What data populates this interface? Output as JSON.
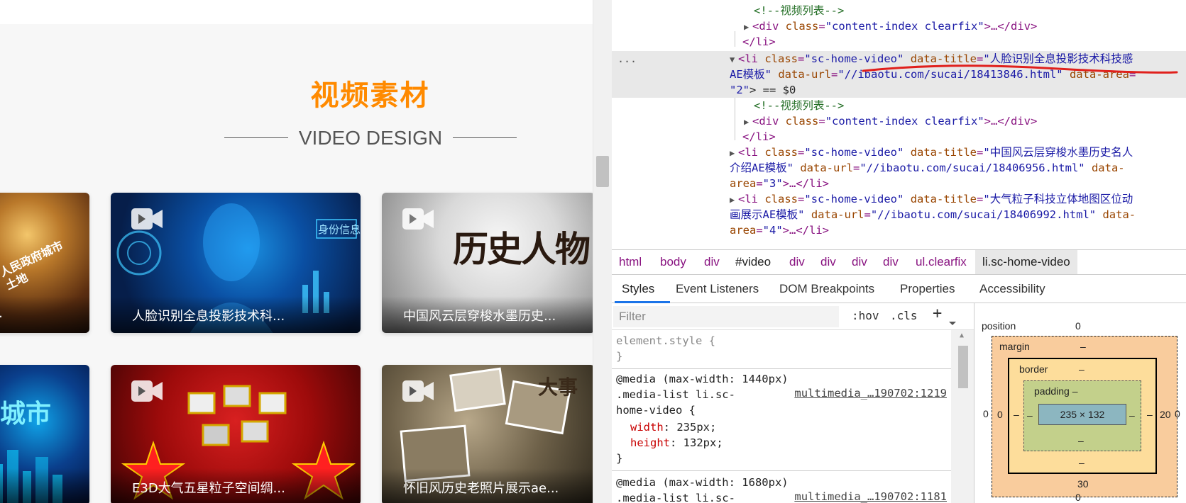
{
  "page": {
    "title_cn": "视频素材",
    "subtitle_en": "VIDEO DESIGN",
    "cards": [
      {
        "caption": "…",
        "art": "人民政府城市土地"
      },
      {
        "caption": "人脸识别全息投影技术科...",
        "art": "身份信息"
      },
      {
        "caption": "中国风云层穿梭水墨历史...",
        "art": "历史人物"
      },
      {
        "caption": "",
        "art": "城市"
      },
      {
        "caption": "E3D大气五星粒子空间绸...",
        "art": ""
      },
      {
        "caption": "怀旧风历史老照片展示ae...",
        "art": "大事"
      }
    ]
  },
  "devtools": {
    "elements": {
      "line0": {
        "comment": "<!--视频列表-->"
      },
      "line1": {
        "tag_open": "<div",
        "attr": "class",
        "val": "\"content-index clearfix\"",
        "rest": ">…</div>"
      },
      "line2": {
        "close": "</li>"
      },
      "line3": {
        "tag_open": "<li",
        "attr1": "class",
        "val1": "\"sc-home-video\"",
        "attr2": "data-title",
        "val2": "\"人脸识别全息投影技术科技感"
      },
      "line4": {
        "val2_cont": "AE模板\"",
        "attr3": "data-url",
        "val3": "\"//ibaotu.com/sucai/18413846.html\"",
        "attr4": "data-area",
        "eq": "="
      },
      "line5": {
        "val4": "\"2\"",
        "rest": "> == $0"
      },
      "line6": {
        "comment": "<!--视频列表-->"
      },
      "line7": {
        "tag_open": "<div",
        "attr": "class",
        "val": "\"content-index clearfix\"",
        "rest": ">…</div>"
      },
      "line8": {
        "close": "</li>"
      },
      "line9": {
        "tag_open": "<li",
        "attr1": "class",
        "val1": "\"sc-home-video\"",
        "attr2": "data-title",
        "val2": "\"中国风云层穿梭水墨历史名人"
      },
      "line10": {
        "val2_cont": "介绍AE模板\"",
        "attr3": "data-url",
        "val3": "\"//ibaotu.com/sucai/18406956.html\"",
        "attr4": "data-"
      },
      "line11": {
        "attr4_cont": "area",
        "val4": "\"3\"",
        "rest": ">…</li>"
      },
      "line12": {
        "tag_open": "<li",
        "attr1": "class",
        "val1": "\"sc-home-video\"",
        "attr2": "data-title",
        "val2": "\"大气粒子科技立体地图区位动"
      },
      "line13": {
        "val2_cont": "画展示AE模板\"",
        "attr3": "data-url",
        "val3": "\"//ibaotu.com/sucai/18406992.html\"",
        "attr4": "data-"
      },
      "line14": {
        "attr4_cont": "area",
        "val4": "\"4\"",
        "rest": ">…</li>"
      },
      "ellipsis": "..."
    },
    "breadcrumbs": [
      "html",
      "body",
      "div",
      "#video",
      "div",
      "div",
      "div",
      "div",
      "ul.clearfix",
      "li.sc-home-video"
    ],
    "tabs": [
      "Styles",
      "Event Listeners",
      "DOM Breakpoints",
      "Properties",
      "Accessibility"
    ],
    "filter_placeholder": "Filter",
    "hov": ":hov",
    "cls": ".cls",
    "plus": "+",
    "styles": {
      "element_style_open": "element.style {",
      "close": "}",
      "media1": "@media (max-width: 1440px)",
      "sel1a": ".media-list li.sc-",
      "sel1b": "home-video {",
      "src1": "multimedia_…190702:1219",
      "prop_width": "width",
      "val_width": "235px;",
      "prop_height": "height",
      "val_height": "132px;",
      "media2": "@media (max-width: 1680px)",
      "sel2a": ".media-list li.sc-",
      "src2": "multimedia_…190702:1181"
    },
    "boxmodel": {
      "position_label": "position",
      "position_top": "0",
      "position_bottom": "0",
      "margin_label": "margin",
      "margin_top": "–",
      "margin_left": "0",
      "margin_right": "20",
      "margin_bottom": "30",
      "border_label": "border",
      "border_top": "–",
      "border_left": "–",
      "border_right": "–",
      "border_bottom": "–",
      "padding_label": "padding –",
      "padding_left": "–",
      "padding_right": "–",
      "padding_bottom": "–",
      "content": "235 × 132",
      "outer_left": "0",
      "outer_right": "0",
      "dash_left": "–",
      "dash_right": "–"
    }
  },
  "colors": {
    "accent_orange": "#ff8a00",
    "tag": "#881280",
    "attr": "#994500",
    "value": "#1a1aa6",
    "comment": "#236e25",
    "tab_underline": "#1a73e8",
    "margin_box": "#f9cc9d",
    "border_box": "#fddd9b",
    "padding_box": "#c3d08b",
    "content_box": "#8cb6c0"
  }
}
